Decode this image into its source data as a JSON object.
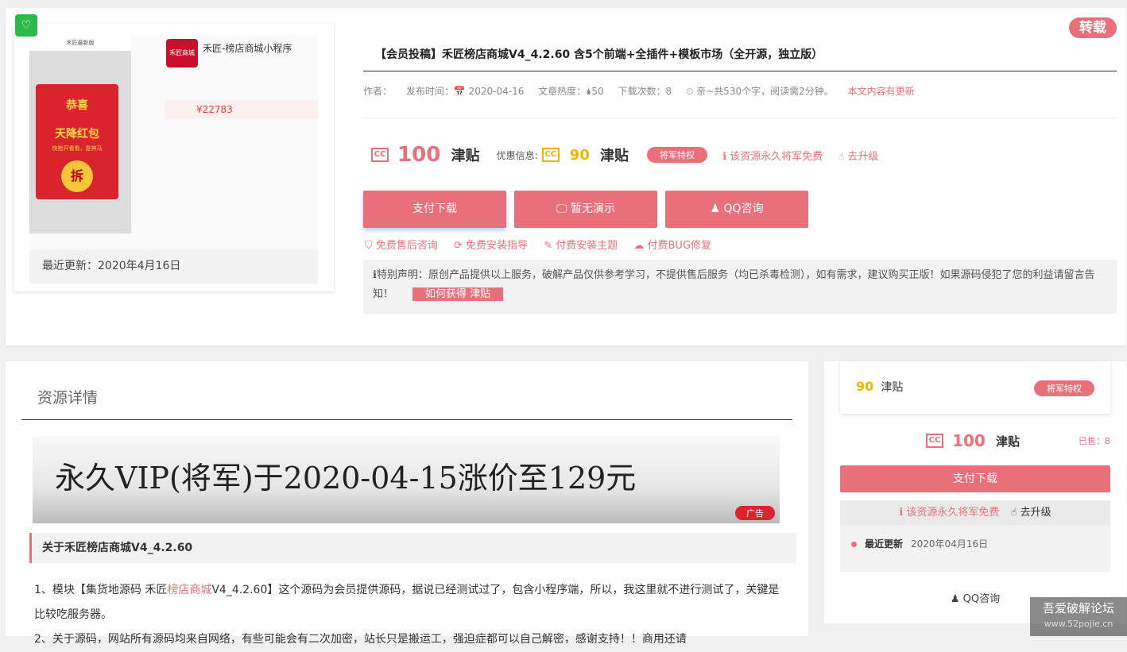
{
  "resource": {
    "badge_glyph": "♡",
    "repost_label": "转载",
    "thumbnail": {
      "phone_title": "禾匠最新版",
      "envelope_line1": "恭喜",
      "envelope_line2": "天降红包",
      "envelope_hint": "快抢开看看，是神马",
      "envelope_coin": "拆",
      "mini_app_title": "禾匠-榜店商城小程序",
      "mini_logo": "禾匠商城",
      "mini_price": "¥22783",
      "date": "最近更新：2020年4月16日"
    },
    "title": "【会员投稿】禾匠榜店商城V4_4.2.60 含5个前端+全插件+模板市场（全开源，独立版）",
    "meta": {
      "author": "作者：",
      "published": "发布时间：📅 2020-04-16",
      "heat": "文章热度：🌢50",
      "downloads": "下载次数：8",
      "read": "⏲ 亲~共530个字，阅读需2分钟。",
      "updated": "本文内容有更新"
    },
    "price": {
      "cc_label": "CC",
      "amount": "100",
      "unit": "津贴",
      "discount_label": "优惠信息:",
      "discount_amount": "90",
      "discount_unit": "津贴",
      "vip_label": "将军特权",
      "free_text": "ℹ 该资源永久将军免费",
      "upgrade_text": "☝ 去升级"
    },
    "buttons": {
      "pay": "支付下载",
      "demo": "🖵 暂无演示",
      "qq": "♟ QQ咨询"
    },
    "services": [
      "⛉ 免费售后咨询",
      "⟳ 免费安装指导",
      "✎ 付费安装主题",
      "☁ 付费BUG修复"
    ],
    "notice": {
      "text": "ℹ特别声明：原创产品提供以上服务，破解产品仅供参考学习，不提供售后服务（均已杀毒检测），如有需求，建议购买正版！如果源码侵犯了您的利益请留言告知！",
      "link": "如何获得 津贴"
    }
  },
  "detail": {
    "section_title": "资源详情",
    "banner_text": "永久VIP(将军)于2020-04-15涨价至129元",
    "ad_label": "广告",
    "about_heading": "关于禾匠榜店商城V4_4.2.60",
    "paragraph1_a": "1、模块【集货地源码 禾匠",
    "paragraph1_link": "榜店商城",
    "paragraph1_b": "V4_4.2.60】这个源码为会员提供源码，据说已经测试过了，包含小程序端，所以，我这里就不进行测试了，关键是比较吃服务器。",
    "paragraph2": "2、关于源码，网站所有源码均来自网络，有些可能会有二次加密，站长只是搬运工，强迫症都可以自己解密，感谢支持！！商用还请"
  },
  "sidebar": {
    "discount_amount": "90",
    "discount_unit": "津贴",
    "vip_label": "将军特权",
    "cc_label": "CC",
    "price_amount": "100",
    "price_unit": "津贴",
    "sold": "已售：8",
    "pay_label": "支付下载",
    "free_text": "ℹ 该资源永久将军免费",
    "upgrade_text": "☝ 去升级",
    "update_label": "最近更新",
    "update_value": "2020年04月16日",
    "qq_label": "♟ QQ咨询"
  },
  "watermark": {
    "name": "吾爱破解论坛",
    "url": "www.52pojie.cn"
  },
  "colors": {
    "accent": "#e8707a",
    "gold": "#f0b400",
    "green": "#2cb94a"
  }
}
